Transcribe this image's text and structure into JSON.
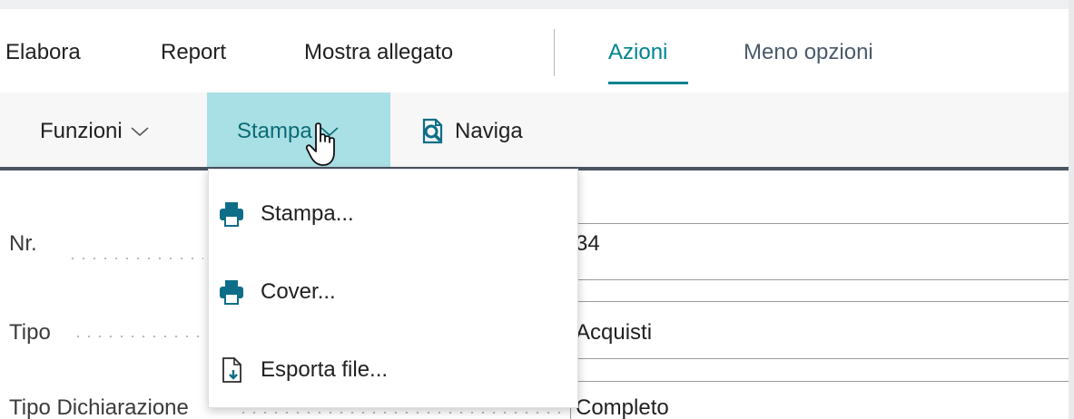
{
  "action_bar": {
    "items": [
      {
        "label": "Elabora"
      },
      {
        "label": "Report"
      },
      {
        "label": "Mostra allegato"
      },
      {
        "label": "Azioni"
      },
      {
        "label": "Meno opzioni"
      }
    ],
    "active": "Azioni"
  },
  "toolbar": {
    "items": [
      {
        "label": "Funzioni",
        "icon": "chevron-down-icon"
      },
      {
        "label": "Stampa",
        "icon": "chevron-down-icon",
        "selected": true
      },
      {
        "label": "Naviga",
        "icon": "navigate-icon"
      }
    ]
  },
  "dropdown": {
    "items": [
      {
        "label": "Stampa...",
        "icon": "printer-icon"
      },
      {
        "label": "Cover...",
        "icon": "printer-icon"
      },
      {
        "label": "Esporta file...",
        "icon": "export-file-icon"
      }
    ]
  },
  "form": {
    "fields": [
      {
        "label": "Nr.",
        "value": "34"
      },
      {
        "label": "Tipo",
        "value": "Acquisti"
      },
      {
        "label": "Tipo Dichiarazione",
        "value": "Completo"
      }
    ]
  },
  "colors": {
    "accent": "#00838f",
    "selected_bg": "#a9e0e5",
    "icon_blue": "#0e6e87"
  }
}
